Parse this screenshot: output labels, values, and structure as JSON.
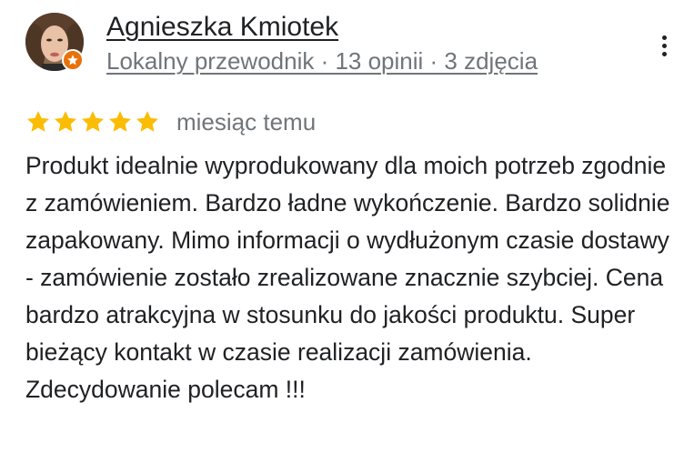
{
  "reviewer": {
    "name": "Agnieszka Kmiotek",
    "meta": "Lokalny przewodnik · 13 opinii · 3 zdjęcia",
    "badge_icon": "local-guide-star-icon",
    "badge_color": "#e8710a"
  },
  "rating": {
    "stars": 5,
    "max_stars": 5,
    "star_color": "#fbbc04",
    "date": "miesiąc temu"
  },
  "review": {
    "text": "Produkt idealnie wyprodukowany dla moich potrzeb zgodnie z zamówieniem. Bardzo ładne wykończenie. Bardzo solidnie zapakowany. Mimo informacji o wydłużonym czasie dostawy - zamówienie zostało zrealizowane znacznie szybciej. Cena bardzo atrakcyjna w stosunku do jakości produktu. Super bieżący kontakt w czasie realizacji zamówienia. Zdecydowanie polecam !!!"
  },
  "icons": {
    "more": "more-vert-icon",
    "star": "star-icon",
    "avatar": "profile-photo"
  }
}
